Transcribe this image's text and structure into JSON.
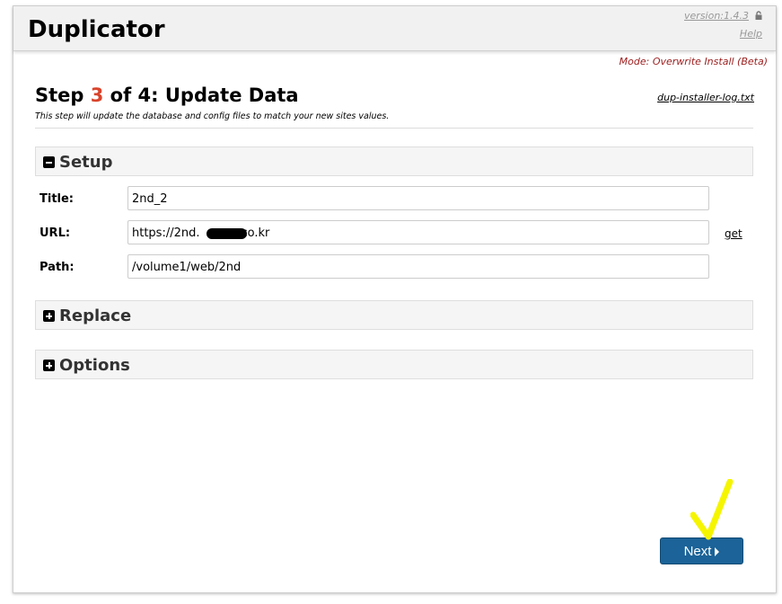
{
  "header": {
    "app_title": "Duplicator",
    "version": "version:1.4.3",
    "help": "Help",
    "mode": "Mode: Overwrite Install (Beta)"
  },
  "step": {
    "title_prefix": "Step ",
    "number": "3",
    "title_suffix": " of 4: Update Data",
    "description": "This step will update the database and config files to match your new sites values.",
    "log_link": "dup-installer-log.txt"
  },
  "sections": {
    "setup": "Setup",
    "replace": "Replace",
    "options": "Options"
  },
  "setup_form": {
    "title_label": "Title:",
    "title_value": "2nd_2",
    "url_label": "URL:",
    "url_value_start": "https://2nd.",
    "url_value_end": "co.kr",
    "get_link": "get",
    "path_label": "Path:",
    "path_value": "/volume1/web/2nd"
  },
  "next_button": "Next",
  "colors": {
    "step_number": "#d9432b",
    "mode_text": "#9b1c1c",
    "next_button": "#1b6398",
    "checkmark": "#f5f500"
  }
}
